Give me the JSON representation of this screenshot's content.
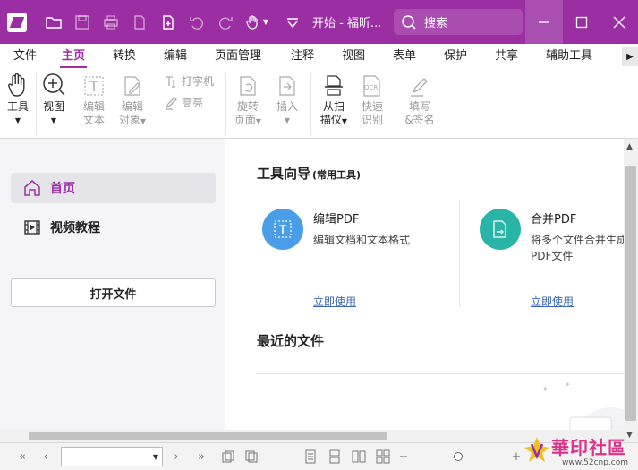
{
  "window": {
    "title": "开始 - 福昕...",
    "search_placeholder": "搜索",
    "accent_color": "#9b2ea3"
  },
  "menu": {
    "tabs": [
      "文件",
      "主页",
      "转换",
      "编辑",
      "页面管理",
      "注释",
      "视图",
      "表单",
      "保护",
      "共享",
      "辅助工具"
    ],
    "active_index": 1
  },
  "ribbon": {
    "tool": {
      "line1": "工具"
    },
    "view": {
      "line1": "视图"
    },
    "edit_text": {
      "line1": "编辑",
      "line2": "文本"
    },
    "edit_object": {
      "line1": "编辑",
      "line2": "对象"
    },
    "typewriter": "打字机",
    "highlight": "高亮",
    "rotate_page": {
      "line1": "旋转",
      "line2": "页面"
    },
    "insert": {
      "line1": "插入"
    },
    "from_scanner": {
      "line1": "从扫",
      "line2": "描仪"
    },
    "quick_ocr": {
      "line1": "快速",
      "line2": "识别",
      "icon_text": "OCR"
    },
    "fill_sign": {
      "line1": "填写",
      "line2": "&签名"
    }
  },
  "sidebar": {
    "items": [
      {
        "label": "首页",
        "icon": "home-icon",
        "active": true
      },
      {
        "label": "视频教程",
        "icon": "film-icon",
        "active": false
      }
    ],
    "open_file_label": "打开文件"
  },
  "main": {
    "tool_guide_title": "工具向导",
    "tool_guide_subtitle": "(常用工具)",
    "tools": [
      {
        "name": "编辑PDF",
        "desc": "编辑文档和文本格式",
        "link": "立即使用",
        "color": "#4a9de8"
      },
      {
        "name": "合并PDF",
        "desc": "将多个文件合并生成PDF文件",
        "link": "立即使用",
        "color": "#28b5a8"
      }
    ],
    "recent_title": "最近的文件"
  },
  "watermark": {
    "text": "華印社區",
    "url": "www.52cnp.com"
  }
}
